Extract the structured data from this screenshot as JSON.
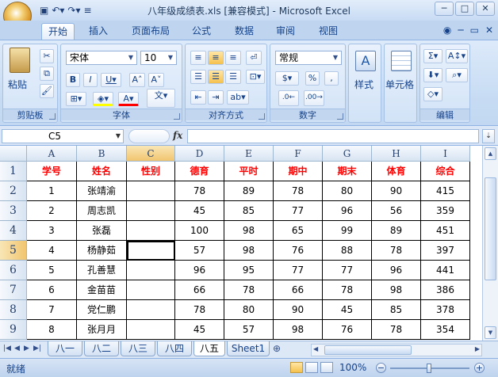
{
  "window": {
    "title": "八年级成绩表.xls  [兼容模式] - Microsoft Excel",
    "controls": [
      "minimize",
      "maximize",
      "close"
    ]
  },
  "ribbon_tabs": [
    "开始",
    "插入",
    "页面布局",
    "公式",
    "数据",
    "审阅",
    "视图"
  ],
  "active_tab": "开始",
  "groups": {
    "clipboard": {
      "label": "剪贴板",
      "paste": "粘贴"
    },
    "font": {
      "label": "字体",
      "font_name": "宋体",
      "font_size": "10"
    },
    "alignment": {
      "label": "对齐方式"
    },
    "number": {
      "label": "数字",
      "format": "常规"
    },
    "styles": {
      "label": "样式"
    },
    "cells": {
      "label": "单元格"
    },
    "editing": {
      "label": "编辑"
    }
  },
  "formula_bar": {
    "name_box": "C5",
    "fx": "fx",
    "formula": ""
  },
  "grid": {
    "columns": [
      "A",
      "B",
      "C",
      "D",
      "E",
      "F",
      "G",
      "H",
      "I"
    ],
    "rows": [
      "1",
      "2",
      "3",
      "4",
      "5",
      "6",
      "7",
      "8",
      "9"
    ],
    "headers": [
      "学号",
      "姓名",
      "性别",
      "德育",
      "平时",
      "期中",
      "期末",
      "体育",
      "综合"
    ],
    "data": [
      [
        "1",
        "张靖渝",
        "",
        "78",
        "89",
        "78",
        "80",
        "90",
        "415"
      ],
      [
        "2",
        "周志凯",
        "",
        "45",
        "85",
        "77",
        "96",
        "56",
        "359"
      ],
      [
        "3",
        "张磊",
        "",
        "100",
        "98",
        "65",
        "99",
        "89",
        "451"
      ],
      [
        "4",
        "杨静茹",
        "",
        "57",
        "98",
        "76",
        "88",
        "78",
        "397"
      ],
      [
        "5",
        "孔善慧",
        "",
        "96",
        "95",
        "77",
        "77",
        "96",
        "441"
      ],
      [
        "6",
        "金苗苗",
        "",
        "66",
        "78",
        "66",
        "78",
        "98",
        "386"
      ],
      [
        "7",
        "党仁鹏",
        "",
        "78",
        "80",
        "90",
        "45",
        "85",
        "378"
      ],
      [
        "8",
        "张月月",
        "",
        "45",
        "57",
        "98",
        "76",
        "78",
        "354"
      ]
    ]
  },
  "sheet_tabs": [
    "八一",
    "八二",
    "八三",
    "八四",
    "八五",
    "Sheet1"
  ],
  "active_sheet": "八五",
  "status": {
    "ready": "就绪",
    "zoom": "100%"
  }
}
